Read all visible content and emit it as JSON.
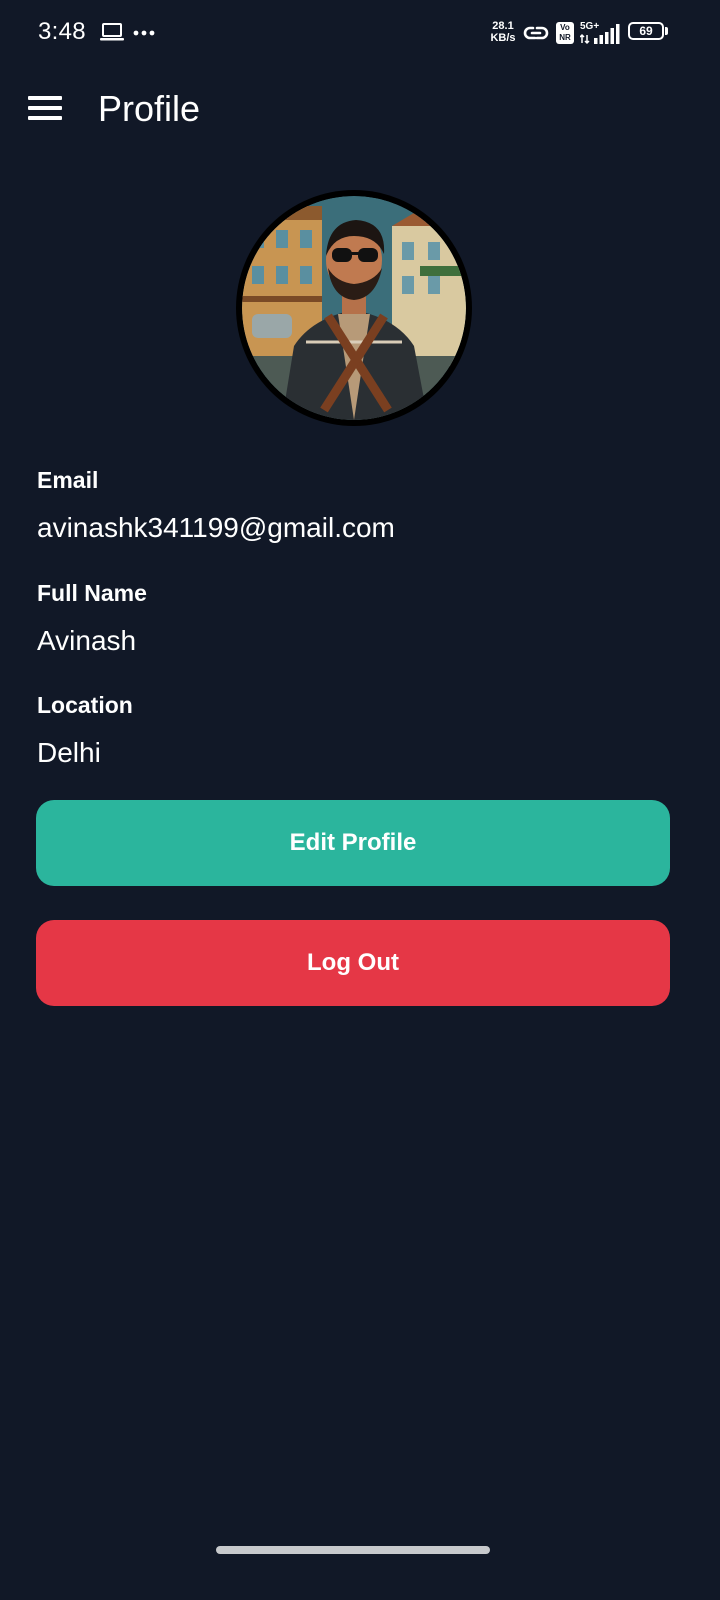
{
  "status_bar": {
    "time": "3:48",
    "net_speed_value": "28.1",
    "net_speed_unit": "KB/s",
    "network_badge_top": "Vo",
    "network_badge_bottom": "NR",
    "network_type": "5G+",
    "battery_level": "69",
    "icons": [
      "laptop-icon",
      "more-icon",
      "link-icon",
      "vonr-icon",
      "signal-icon",
      "battery-icon"
    ]
  },
  "app_bar": {
    "title": "Profile",
    "menu_icon": "hamburger-menu-icon"
  },
  "profile": {
    "avatar_alt": "avatar",
    "fields": [
      {
        "label": "Email",
        "value": "avinashk341199@gmail.com"
      },
      {
        "label": "Full Name",
        "value": "Avinash"
      },
      {
        "label": "Location",
        "value": "Delhi"
      }
    ]
  },
  "actions": {
    "edit_label": "Edit Profile",
    "logout_label": "Log Out"
  },
  "colors": {
    "background": "#111827",
    "edit_button": "#2bb59d",
    "logout_button": "#e53746",
    "text": "#ffffff"
  }
}
